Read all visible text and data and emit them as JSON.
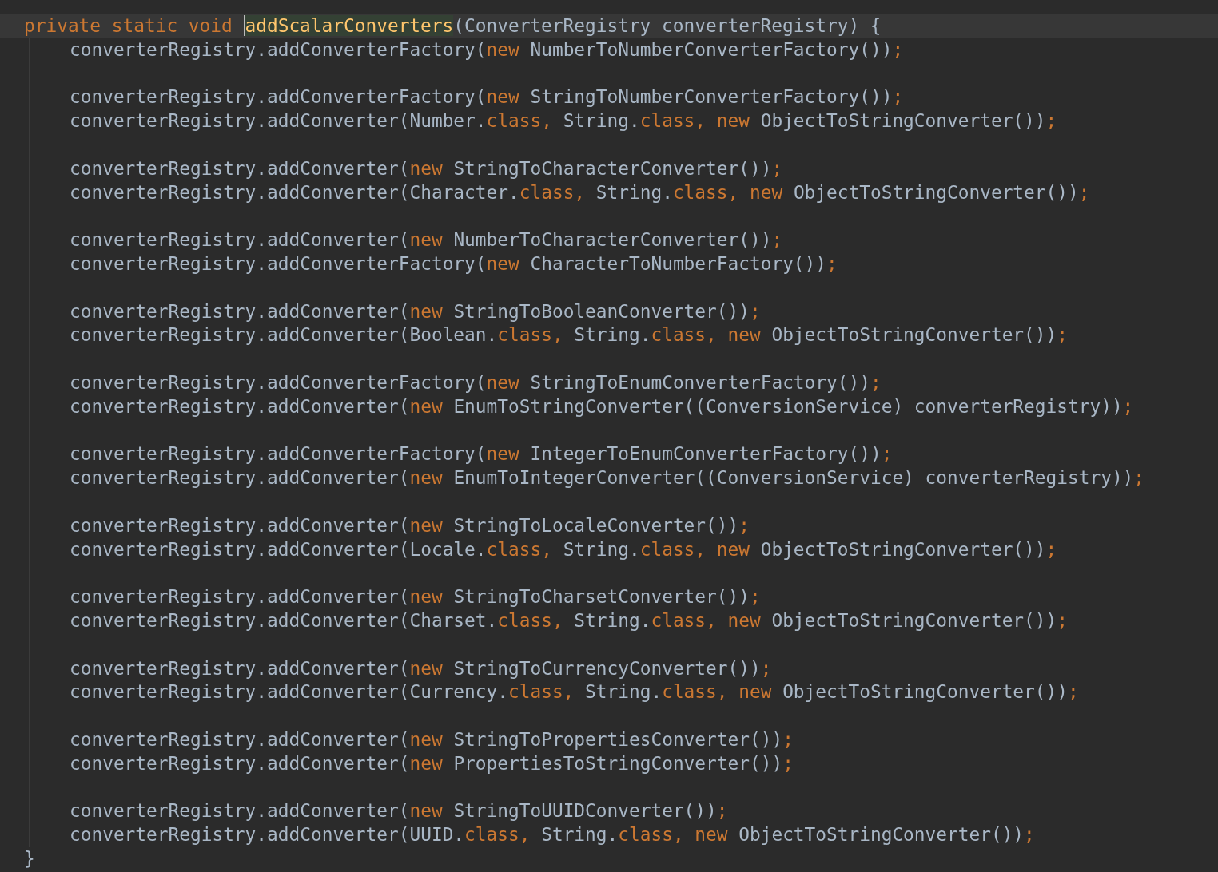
{
  "editor": {
    "lines": [
      {
        "kind": "code",
        "current": true,
        "indented": false,
        "tokens": [
          {
            "kind": "keyword",
            "text": "private static void "
          },
          {
            "kind": "declaration",
            "text": "addScalarConverters"
          },
          {
            "kind": "plain",
            "text": "(ConverterRegistry converterRegistry) {"
          }
        ]
      },
      {
        "kind": "code",
        "current": false,
        "indented": true,
        "tokens": [
          {
            "kind": "plain",
            "text": "converterRegistry.addConverterFactory("
          },
          {
            "kind": "keyword",
            "text": "new "
          },
          {
            "kind": "plain",
            "text": "NumberToNumberConverterFactory())"
          },
          {
            "kind": "keyword",
            "text": ";"
          }
        ]
      },
      {
        "kind": "blank",
        "current": false,
        "indented": true
      },
      {
        "kind": "code",
        "current": false,
        "indented": true,
        "tokens": [
          {
            "kind": "plain",
            "text": "converterRegistry.addConverterFactory("
          },
          {
            "kind": "keyword",
            "text": "new "
          },
          {
            "kind": "plain",
            "text": "StringToNumberConverterFactory())"
          },
          {
            "kind": "keyword",
            "text": ";"
          }
        ]
      },
      {
        "kind": "code",
        "current": false,
        "indented": true,
        "tokens": [
          {
            "kind": "plain",
            "text": "converterRegistry.addConverter(Number."
          },
          {
            "kind": "keyword",
            "text": "class, "
          },
          {
            "kind": "plain",
            "text": "String."
          },
          {
            "kind": "keyword",
            "text": "class, new "
          },
          {
            "kind": "plain",
            "text": "ObjectToStringConverter())"
          },
          {
            "kind": "keyword",
            "text": ";"
          }
        ]
      },
      {
        "kind": "blank",
        "current": false,
        "indented": true
      },
      {
        "kind": "code",
        "current": false,
        "indented": true,
        "tokens": [
          {
            "kind": "plain",
            "text": "converterRegistry.addConverter("
          },
          {
            "kind": "keyword",
            "text": "new "
          },
          {
            "kind": "plain",
            "text": "StringToCharacterConverter())"
          },
          {
            "kind": "keyword",
            "text": ";"
          }
        ]
      },
      {
        "kind": "code",
        "current": false,
        "indented": true,
        "tokens": [
          {
            "kind": "plain",
            "text": "converterRegistry.addConverter(Character."
          },
          {
            "kind": "keyword",
            "text": "class, "
          },
          {
            "kind": "plain",
            "text": "String."
          },
          {
            "kind": "keyword",
            "text": "class, new "
          },
          {
            "kind": "plain",
            "text": "ObjectToStringConverter())"
          },
          {
            "kind": "keyword",
            "text": ";"
          }
        ]
      },
      {
        "kind": "blank",
        "current": false,
        "indented": true
      },
      {
        "kind": "code",
        "current": false,
        "indented": true,
        "tokens": [
          {
            "kind": "plain",
            "text": "converterRegistry.addConverter("
          },
          {
            "kind": "keyword",
            "text": "new "
          },
          {
            "kind": "plain",
            "text": "NumberToCharacterConverter())"
          },
          {
            "kind": "keyword",
            "text": ";"
          }
        ]
      },
      {
        "kind": "code",
        "current": false,
        "indented": true,
        "tokens": [
          {
            "kind": "plain",
            "text": "converterRegistry.addConverterFactory("
          },
          {
            "kind": "keyword",
            "text": "new "
          },
          {
            "kind": "plain",
            "text": "CharacterToNumberFactory())"
          },
          {
            "kind": "keyword",
            "text": ";"
          }
        ]
      },
      {
        "kind": "blank",
        "current": false,
        "indented": true
      },
      {
        "kind": "code",
        "current": false,
        "indented": true,
        "tokens": [
          {
            "kind": "plain",
            "text": "converterRegistry.addConverter("
          },
          {
            "kind": "keyword",
            "text": "new "
          },
          {
            "kind": "plain",
            "text": "StringToBooleanConverter())"
          },
          {
            "kind": "keyword",
            "text": ";"
          }
        ]
      },
      {
        "kind": "code",
        "current": false,
        "indented": true,
        "tokens": [
          {
            "kind": "plain",
            "text": "converterRegistry.addConverter(Boolean."
          },
          {
            "kind": "keyword",
            "text": "class, "
          },
          {
            "kind": "plain",
            "text": "String."
          },
          {
            "kind": "keyword",
            "text": "class, new "
          },
          {
            "kind": "plain",
            "text": "ObjectToStringConverter())"
          },
          {
            "kind": "keyword",
            "text": ";"
          }
        ]
      },
      {
        "kind": "blank",
        "current": false,
        "indented": true
      },
      {
        "kind": "code",
        "current": false,
        "indented": true,
        "tokens": [
          {
            "kind": "plain",
            "text": "converterRegistry.addConverterFactory("
          },
          {
            "kind": "keyword",
            "text": "new "
          },
          {
            "kind": "plain",
            "text": "StringToEnumConverterFactory())"
          },
          {
            "kind": "keyword",
            "text": ";"
          }
        ]
      },
      {
        "kind": "code",
        "current": false,
        "indented": true,
        "tokens": [
          {
            "kind": "plain",
            "text": "converterRegistry.addConverter("
          },
          {
            "kind": "keyword",
            "text": "new "
          },
          {
            "kind": "plain",
            "text": "EnumToStringConverter((ConversionService) converterRegistry))"
          },
          {
            "kind": "keyword",
            "text": ";"
          }
        ]
      },
      {
        "kind": "blank",
        "current": false,
        "indented": true
      },
      {
        "kind": "code",
        "current": false,
        "indented": true,
        "tokens": [
          {
            "kind": "plain",
            "text": "converterRegistry.addConverterFactory("
          },
          {
            "kind": "keyword",
            "text": "new "
          },
          {
            "kind": "plain",
            "text": "IntegerToEnumConverterFactory())"
          },
          {
            "kind": "keyword",
            "text": ";"
          }
        ]
      },
      {
        "kind": "code",
        "current": false,
        "indented": true,
        "tokens": [
          {
            "kind": "plain",
            "text": "converterRegistry.addConverter("
          },
          {
            "kind": "keyword",
            "text": "new "
          },
          {
            "kind": "plain",
            "text": "EnumToIntegerConverter((ConversionService) converterRegistry))"
          },
          {
            "kind": "keyword",
            "text": ";"
          }
        ]
      },
      {
        "kind": "blank",
        "current": false,
        "indented": true
      },
      {
        "kind": "code",
        "current": false,
        "indented": true,
        "tokens": [
          {
            "kind": "plain",
            "text": "converterRegistry.addConverter("
          },
          {
            "kind": "keyword",
            "text": "new "
          },
          {
            "kind": "plain",
            "text": "StringToLocaleConverter())"
          },
          {
            "kind": "keyword",
            "text": ";"
          }
        ]
      },
      {
        "kind": "code",
        "current": false,
        "indented": true,
        "tokens": [
          {
            "kind": "plain",
            "text": "converterRegistry.addConverter(Locale."
          },
          {
            "kind": "keyword",
            "text": "class, "
          },
          {
            "kind": "plain",
            "text": "String."
          },
          {
            "kind": "keyword",
            "text": "class, new "
          },
          {
            "kind": "plain",
            "text": "ObjectToStringConverter())"
          },
          {
            "kind": "keyword",
            "text": ";"
          }
        ]
      },
      {
        "kind": "blank",
        "current": false,
        "indented": true
      },
      {
        "kind": "code",
        "current": false,
        "indented": true,
        "tokens": [
          {
            "kind": "plain",
            "text": "converterRegistry.addConverter("
          },
          {
            "kind": "keyword",
            "text": "new "
          },
          {
            "kind": "plain",
            "text": "StringToCharsetConverter())"
          },
          {
            "kind": "keyword",
            "text": ";"
          }
        ]
      },
      {
        "kind": "code",
        "current": false,
        "indented": true,
        "tokens": [
          {
            "kind": "plain",
            "text": "converterRegistry.addConverter(Charset."
          },
          {
            "kind": "keyword",
            "text": "class, "
          },
          {
            "kind": "plain",
            "text": "String."
          },
          {
            "kind": "keyword",
            "text": "class, new "
          },
          {
            "kind": "plain",
            "text": "ObjectToStringConverter())"
          },
          {
            "kind": "keyword",
            "text": ";"
          }
        ]
      },
      {
        "kind": "blank",
        "current": false,
        "indented": true
      },
      {
        "kind": "code",
        "current": false,
        "indented": true,
        "tokens": [
          {
            "kind": "plain",
            "text": "converterRegistry.addConverter("
          },
          {
            "kind": "keyword",
            "text": "new "
          },
          {
            "kind": "plain",
            "text": "StringToCurrencyConverter())"
          },
          {
            "kind": "keyword",
            "text": ";"
          }
        ]
      },
      {
        "kind": "code",
        "current": false,
        "indented": true,
        "tokens": [
          {
            "kind": "plain",
            "text": "converterRegistry.addConverter(Currency."
          },
          {
            "kind": "keyword",
            "text": "class, "
          },
          {
            "kind": "plain",
            "text": "String."
          },
          {
            "kind": "keyword",
            "text": "class, new "
          },
          {
            "kind": "plain",
            "text": "ObjectToStringConverter())"
          },
          {
            "kind": "keyword",
            "text": ";"
          }
        ]
      },
      {
        "kind": "blank",
        "current": false,
        "indented": true
      },
      {
        "kind": "code",
        "current": false,
        "indented": true,
        "tokens": [
          {
            "kind": "plain",
            "text": "converterRegistry.addConverter("
          },
          {
            "kind": "keyword",
            "text": "new "
          },
          {
            "kind": "plain",
            "text": "StringToPropertiesConverter())"
          },
          {
            "kind": "keyword",
            "text": ";"
          }
        ]
      },
      {
        "kind": "code",
        "current": false,
        "indented": true,
        "tokens": [
          {
            "kind": "plain",
            "text": "converterRegistry.addConverter("
          },
          {
            "kind": "keyword",
            "text": "new "
          },
          {
            "kind": "plain",
            "text": "PropertiesToStringConverter())"
          },
          {
            "kind": "keyword",
            "text": ";"
          }
        ]
      },
      {
        "kind": "blank",
        "current": false,
        "indented": true
      },
      {
        "kind": "code",
        "current": false,
        "indented": true,
        "tokens": [
          {
            "kind": "plain",
            "text": "converterRegistry.addConverter("
          },
          {
            "kind": "keyword",
            "text": "new "
          },
          {
            "kind": "plain",
            "text": "StringToUUIDConverter())"
          },
          {
            "kind": "keyword",
            "text": ";"
          }
        ]
      },
      {
        "kind": "code",
        "current": false,
        "indented": true,
        "tokens": [
          {
            "kind": "plain",
            "text": "converterRegistry.addConverter(UUID."
          },
          {
            "kind": "keyword",
            "text": "class, "
          },
          {
            "kind": "plain",
            "text": "String."
          },
          {
            "kind": "keyword",
            "text": "class, new "
          },
          {
            "kind": "plain",
            "text": "ObjectToStringConverter())"
          },
          {
            "kind": "keyword",
            "text": ";"
          }
        ]
      },
      {
        "kind": "code",
        "current": false,
        "indented": false,
        "tokens": [
          {
            "kind": "plain",
            "text": "}"
          }
        ]
      }
    ]
  }
}
